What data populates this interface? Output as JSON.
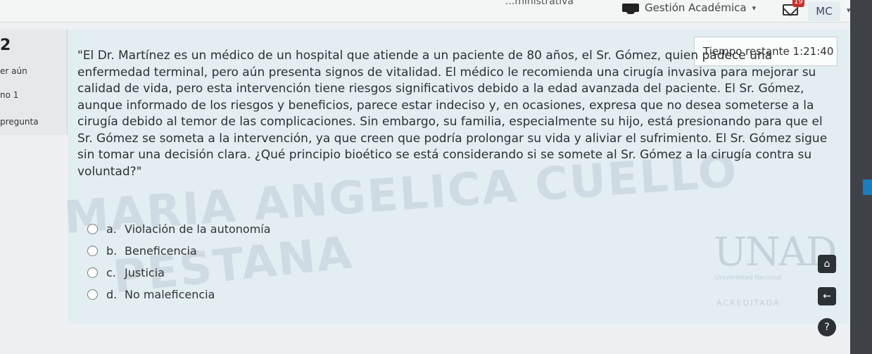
{
  "topbar": {
    "partial_menu": "...ministrativa",
    "nav_label": "Gestión Académica",
    "mail_badge": "19",
    "user_initials": "MC"
  },
  "side": {
    "question_number": "2",
    "line1": "er aún",
    "line2": "no 1",
    "line3": "pregunta"
  },
  "timer": {
    "label": "Tiempo restante",
    "value": "1:21:40"
  },
  "question": {
    "text": "\"El Dr. Martínez es un médico de un hospital que atiende a un paciente de 80 años, el Sr. Gómez, quien padece una enfermedad terminal, pero aún presenta signos de vitalidad. El médico le recomienda una cirugía invasiva para mejorar su calidad de vida, pero esta intervención tiene riesgos significativos debido a la edad avanzada del paciente. El Sr. Gómez, aunque informado de los riesgos y beneficios, parece estar indeciso y, en ocasiones, expresa que no desea someterse a la cirugía debido al temor de las complicaciones. Sin embargo, su familia, especialmente su hijo, está presionando para que el Sr. Gómez se someta a la intervención, ya que creen que podría prolongar su vida y aliviar el sufrimiento. El Sr. Gómez sigue sin tomar una decisión clara. ¿Qué principio bioético se está considerando si se somete al Sr. Gómez a la cirugía contra su voluntad?\""
  },
  "options": [
    {
      "letter": "a.",
      "text": "Violación de la autonomía"
    },
    {
      "letter": "b.",
      "text": "Beneficencia"
    },
    {
      "letter": "c.",
      "text": "Justicia"
    },
    {
      "letter": "d.",
      "text": "No maleficencia"
    }
  ],
  "logo": {
    "name": "UNAD",
    "subtitle": "Universidad Nacional",
    "acreditada": "ACREDITADA"
  },
  "watermark": {
    "line1": "MARIA ANGELICA CUELLO",
    "line2": "PESTANA"
  },
  "icons": {
    "home": "home-icon",
    "back": "arrow-left-icon",
    "help": "help-icon"
  }
}
